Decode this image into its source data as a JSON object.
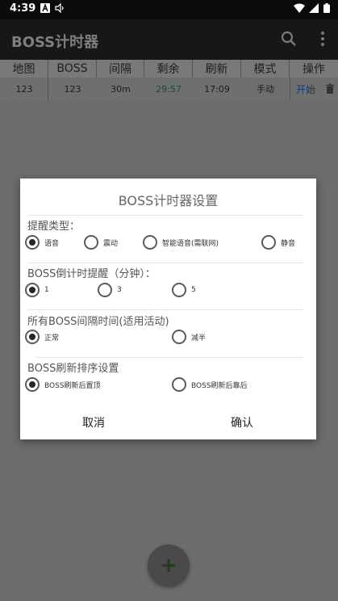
{
  "status_bar": {
    "time": "4:39"
  },
  "app_bar": {
    "title": "BOSS计时器"
  },
  "table": {
    "headers": [
      "地图",
      "BOSS",
      "间隔",
      "剩余",
      "刷新",
      "模式",
      "操作"
    ],
    "row": {
      "map": "123",
      "boss": "123",
      "interval": "30m",
      "remaining": "29:57",
      "refresh": "17:09",
      "mode": "手动",
      "action": "开始"
    }
  },
  "dialog": {
    "title": "BOSS计时器设置",
    "sections": [
      {
        "title": "提醒类型：",
        "options": [
          "语音",
          "震动",
          "智能语音(需联网)",
          "静音"
        ],
        "selected": 0
      },
      {
        "title": "BOSS倒计时提醒（分钟）：",
        "options": [
          "1",
          "3",
          "5"
        ],
        "selected": 0
      },
      {
        "title": "所有BOSS间隔时间(适用活动)",
        "options": [
          "正常",
          "减半"
        ],
        "selected": 0
      },
      {
        "title": "BOSS刷新排序设置",
        "options": [
          "BOSS刷新后置顶",
          "BOSS刷新后靠后"
        ],
        "selected": 0
      }
    ],
    "cancel_label": "取消",
    "confirm_label": "确认"
  },
  "fab": {
    "label": "+"
  }
}
